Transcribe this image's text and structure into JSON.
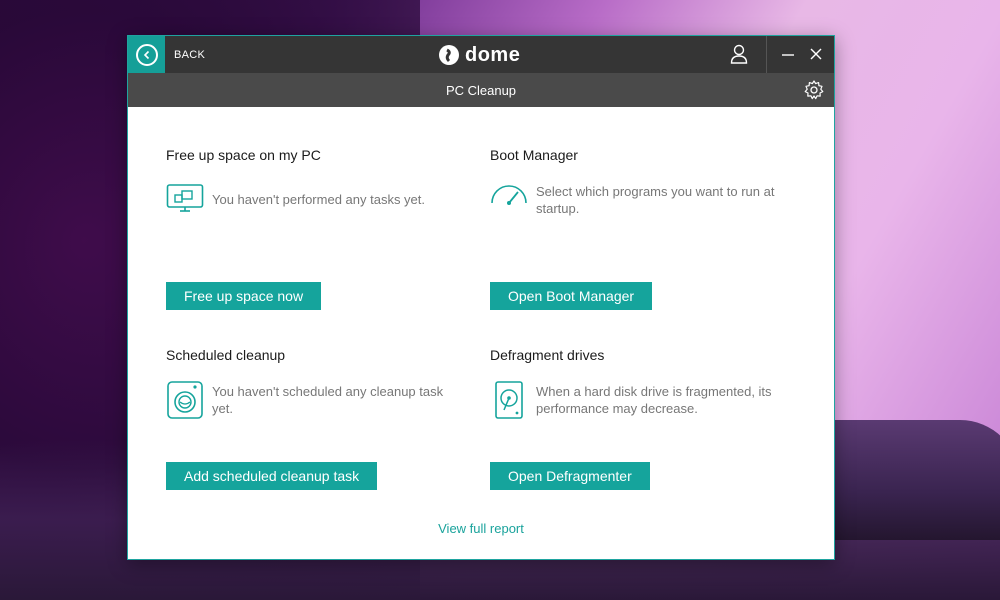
{
  "window": {
    "back_label": "BACK",
    "logo_text": "dome",
    "subtitle": "PC Cleanup"
  },
  "cards": {
    "free_space": {
      "title": "Free up space on my PC",
      "description": "You haven't performed any tasks yet.",
      "button": "Free up space now",
      "icon": "monitor-icon"
    },
    "boot_manager": {
      "title": "Boot Manager",
      "description_line1": "Select which programs you want to run at",
      "description_line2": "startup.",
      "button": "Open Boot Manager",
      "icon": "speedometer-icon"
    },
    "scheduled": {
      "title": "Scheduled cleanup",
      "description_line1": "You haven't scheduled any cleanup task",
      "description_line2": "yet.",
      "button": "Add scheduled cleanup task",
      "icon": "washing-machine-icon"
    },
    "defrag": {
      "title": "Defragment drives",
      "description_line1": "When a hard disk drive is fragmented, its",
      "description_line2": "performance may decrease.",
      "button": "Open Defragmenter",
      "icon": "hard-drive-icon"
    }
  },
  "footer": {
    "report_link": "View full report"
  },
  "colors": {
    "accent": "#15a49c",
    "titlebar": "#353535",
    "subbar": "#4a4a4a"
  }
}
